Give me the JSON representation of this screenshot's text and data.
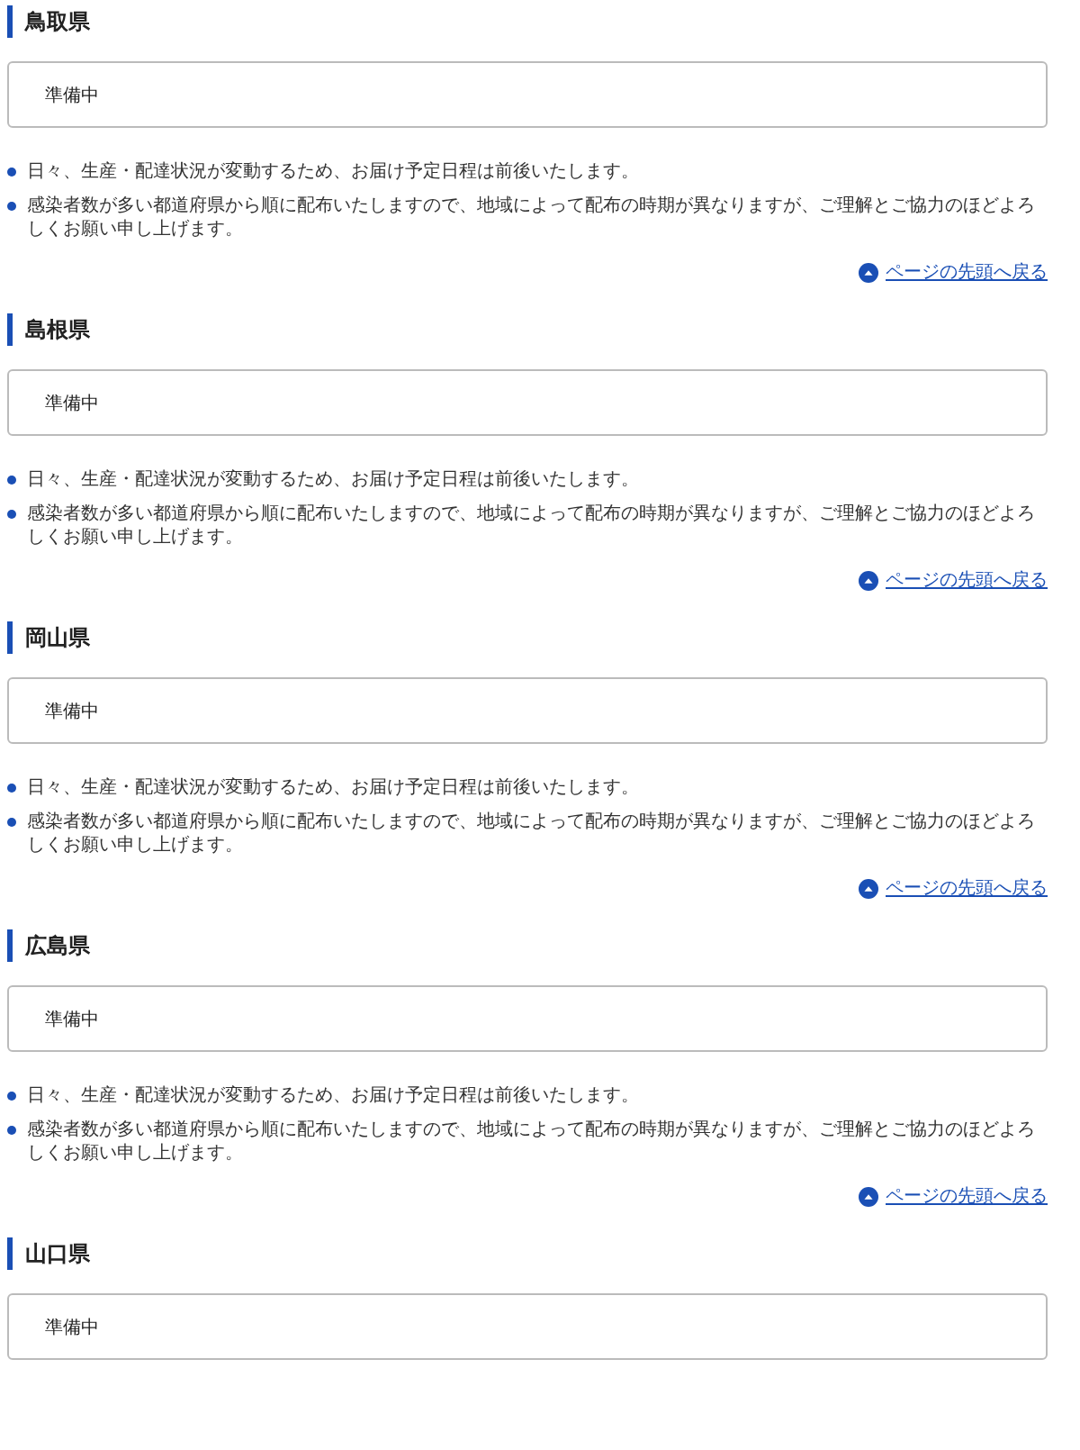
{
  "sections": [
    {
      "title": "鳥取県",
      "status": "準備中",
      "notes": [
        "日々、生産・配達状況が変動するため、お届け予定日程は前後いたします。",
        "感染者数が多い都道府県から順に配布いたしますので、地域によって配布の時期が異なりますが、ご理解とご協力のほどよろしくお願い申し上げます。"
      ],
      "back_link": "ページの先頭へ戻る"
    },
    {
      "title": "島根県",
      "status": "準備中",
      "notes": [
        "日々、生産・配達状況が変動するため、お届け予定日程は前後いたします。",
        "感染者数が多い都道府県から順に配布いたしますので、地域によって配布の時期が異なりますが、ご理解とご協力のほどよろしくお願い申し上げます。"
      ],
      "back_link": "ページの先頭へ戻る"
    },
    {
      "title": "岡山県",
      "status": "準備中",
      "notes": [
        "日々、生産・配達状況が変動するため、お届け予定日程は前後いたします。",
        "感染者数が多い都道府県から順に配布いたしますので、地域によって配布の時期が異なりますが、ご理解とご協力のほどよろしくお願い申し上げます。"
      ],
      "back_link": "ページの先頭へ戻る"
    },
    {
      "title": "広島県",
      "status": "準備中",
      "notes": [
        "日々、生産・配達状況が変動するため、お届け予定日程は前後いたします。",
        "感染者数が多い都道府県から順に配布いたしますので、地域によって配布の時期が異なりますが、ご理解とご協力のほどよろしくお願い申し上げます。"
      ],
      "back_link": "ページの先頭へ戻る"
    },
    {
      "title": "山口県",
      "status": "準備中"
    }
  ]
}
